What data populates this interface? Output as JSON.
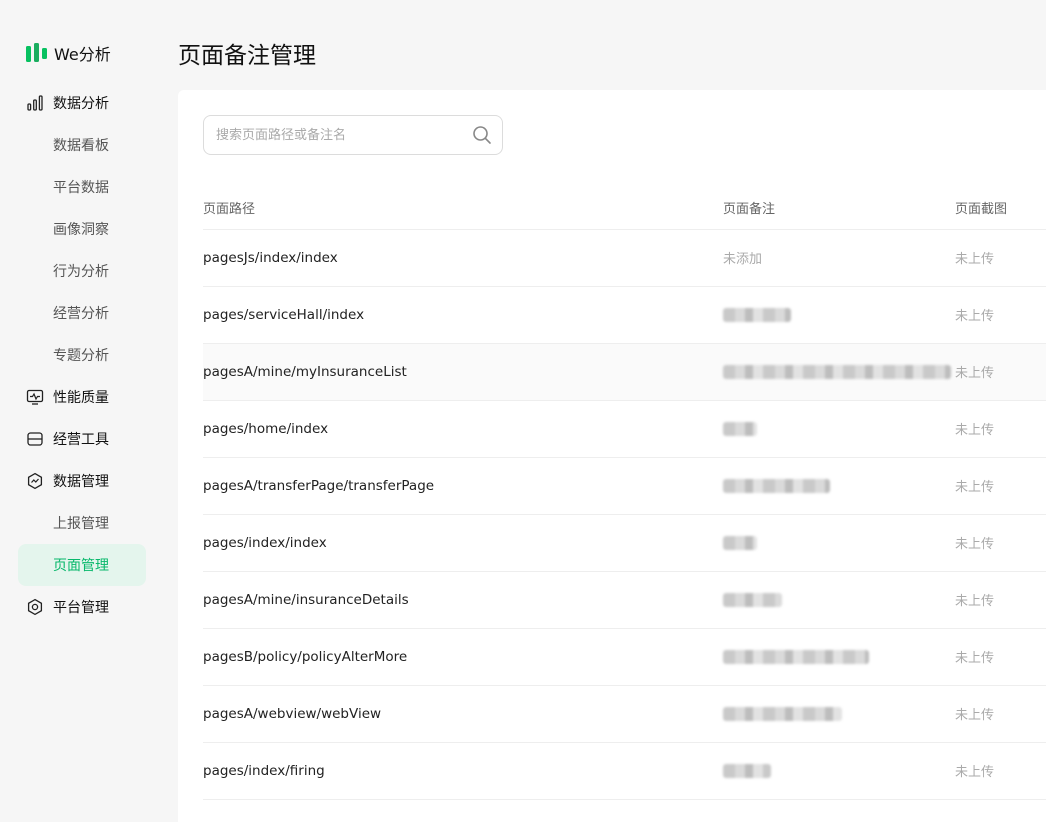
{
  "app": {
    "name": "We分析"
  },
  "page": {
    "title": "页面备注管理"
  },
  "sidebar": {
    "items": [
      {
        "label": "数据分析",
        "icon": "bar-chart-icon",
        "type": "group"
      },
      {
        "label": "数据看板",
        "type": "sub"
      },
      {
        "label": "平台数据",
        "type": "sub"
      },
      {
        "label": "画像洞察",
        "type": "sub"
      },
      {
        "label": "行为分析",
        "type": "sub"
      },
      {
        "label": "经营分析",
        "type": "sub"
      },
      {
        "label": "专题分析",
        "type": "sub"
      },
      {
        "label": "性能质量",
        "icon": "monitor-icon",
        "type": "group"
      },
      {
        "label": "经营工具",
        "icon": "toolbox-icon",
        "type": "group"
      },
      {
        "label": "数据管理",
        "icon": "data-manage-icon",
        "type": "group"
      },
      {
        "label": "上报管理",
        "type": "sub"
      },
      {
        "label": "页面管理",
        "type": "sub",
        "active": true
      },
      {
        "label": "平台管理",
        "icon": "settings-hex-icon",
        "type": "group"
      }
    ]
  },
  "search": {
    "placeholder": "搜索页面路径或备注名",
    "value": ""
  },
  "table": {
    "headers": [
      "页面路径",
      "页面备注",
      "页面截图"
    ],
    "rows": [
      {
        "path": "pagesJs/index/index",
        "note": "未添加",
        "screenshot": "未上传"
      },
      {
        "path": "pages/serviceHall/index",
        "note_blur": 0.3,
        "screenshot": "未上传"
      },
      {
        "path": "pagesA/mine/myInsuranceList",
        "note_blur": 1.0,
        "screenshot": "未上传"
      },
      {
        "path": "pages/home/index",
        "note_blur": 0.15,
        "screenshot": "未上传"
      },
      {
        "path": "pagesA/transferPage/transferPage",
        "note_blur": 0.47,
        "screenshot": "未上传"
      },
      {
        "path": "pages/index/index",
        "note_blur": 0.15,
        "screenshot": "未上传"
      },
      {
        "path": "pagesA/mine/insuranceDetails",
        "note_blur": 0.26,
        "screenshot": "未上传"
      },
      {
        "path": "pagesB/policy/policyAlterMore",
        "note_blur": 0.64,
        "screenshot": "未上传"
      },
      {
        "path": "pagesA/webview/webView",
        "note_blur": 0.52,
        "screenshot": "未上传"
      },
      {
        "path": "pages/index/firing",
        "note_blur": 0.21,
        "screenshot": "未上传"
      }
    ]
  },
  "colors": {
    "accent": "#07b86b",
    "active_bg": "#e4f5ed"
  }
}
